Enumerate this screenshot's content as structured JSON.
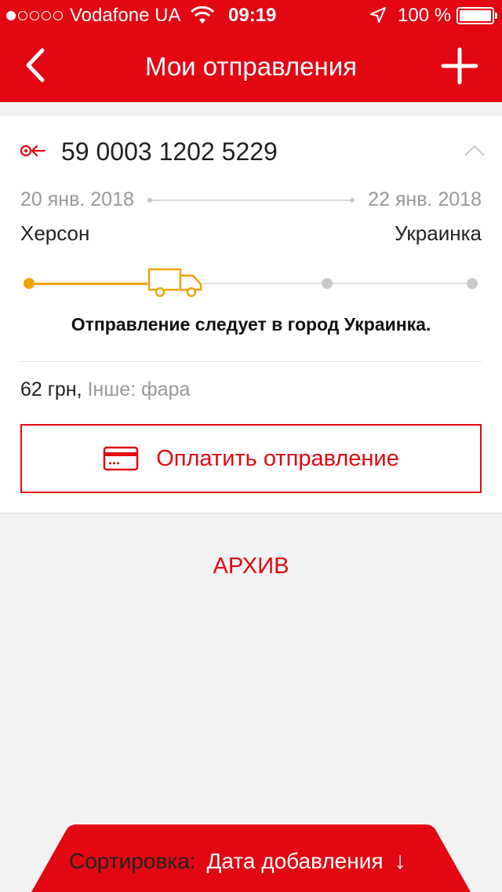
{
  "status_bar": {
    "carrier": "Vodafone UA",
    "time": "09:19",
    "battery": "100 %"
  },
  "nav": {
    "title": "Мои отправления",
    "back_icon": "chevron-left-icon",
    "add_icon": "plus-icon"
  },
  "shipment": {
    "tracking_number": "59 0003 1202 5229",
    "date_from": "20 янв. 2018",
    "date_to": "22 янв. 2018",
    "city_from": "Херсон",
    "city_to": "Украинка",
    "progress_step": 2,
    "progress_steps": 4,
    "status": "Отправление следует в город Украинка.",
    "price": "62 грн,",
    "description": "Інше: фара",
    "pay_label": "Оплатить отправление"
  },
  "archive_label": "АРХИВ",
  "sort": {
    "label": "Сортировка:",
    "value": "Дата добавления",
    "arrow": "↓"
  },
  "colors": {
    "brand": "#e30613",
    "progress": "#f0a30a"
  }
}
